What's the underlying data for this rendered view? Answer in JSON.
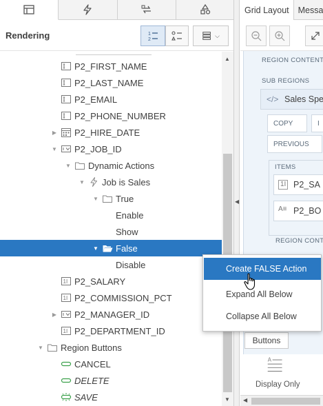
{
  "left_panel": {
    "title": "Rendering",
    "tabs": [
      "rendering-tab-icon",
      "dynamic-actions-tab-icon",
      "processing-tab-icon",
      "shared-components-tab-icon"
    ]
  },
  "tree": [
    {
      "label": "P2_FIRST_NAME",
      "icon": "item-text-icon",
      "toggle": ""
    },
    {
      "label": "P2_LAST_NAME",
      "icon": "item-text-icon",
      "toggle": ""
    },
    {
      "label": "P2_EMAIL",
      "icon": "item-text-icon",
      "toggle": ""
    },
    {
      "label": "P2_PHONE_NUMBER",
      "icon": "item-text-icon",
      "toggle": ""
    },
    {
      "label": "P2_HIRE_DATE",
      "icon": "item-date-icon",
      "toggle": "▶"
    },
    {
      "label": "P2_JOB_ID",
      "icon": "item-select-icon",
      "toggle": "▼"
    },
    {
      "label": "Dynamic Actions",
      "icon": "folder-icon",
      "toggle": "▼"
    },
    {
      "label": "Job is Sales",
      "icon": "lightning-icon",
      "toggle": "▼"
    },
    {
      "label": "True",
      "icon": "folder-icon",
      "toggle": "▼"
    },
    {
      "label": "Enable",
      "icon": "",
      "toggle": ""
    },
    {
      "label": "Show",
      "icon": "",
      "toggle": ""
    },
    {
      "label": "False",
      "icon": "folder-open-icon",
      "toggle": "▼"
    },
    {
      "label": "Disable",
      "icon": "",
      "toggle": ""
    },
    {
      "label": "P2_SALARY",
      "icon": "item-number-icon",
      "toggle": ""
    },
    {
      "label": "P2_COMMISSION_PCT",
      "icon": "item-number-icon",
      "toggle": ""
    },
    {
      "label": "P2_MANAGER_ID",
      "icon": "item-select-icon",
      "toggle": "▶"
    },
    {
      "label": "P2_DEPARTMENT_ID",
      "icon": "item-number-icon",
      "toggle": ""
    },
    {
      "label": "Region Buttons",
      "icon": "folder-icon",
      "toggle": "▼"
    },
    {
      "label": "CANCEL",
      "icon": "button-icon",
      "toggle": ""
    },
    {
      "label": "DELETE",
      "icon": "button-icon",
      "toggle": ""
    },
    {
      "label": "SAVE",
      "icon": "button-dashed-icon",
      "toggle": ""
    }
  ],
  "right_panel": {
    "tabs": {
      "grid_layout": "Grid Layout",
      "messages": "Messa"
    },
    "region_content": "REGION CONTENT",
    "sub_regions": "SUB REGIONS",
    "sales_region": "Sales Spe",
    "copy": "COPY",
    "previous": "PREVIOUS",
    "items": "ITEMS",
    "item1": "P2_SA",
    "item2": "P2_BO",
    "region_content2": "REGION CONT",
    "buttons": "Buttons",
    "display_only": "Display Only"
  },
  "context_menu": {
    "items": [
      "Create FALSE Action",
      "Expand All Below",
      "Collapse All Below"
    ],
    "highlighted": "Create FALSE Action"
  },
  "colors": {
    "selection": "#2a78c2",
    "grid_bg": "#eef4fa"
  }
}
